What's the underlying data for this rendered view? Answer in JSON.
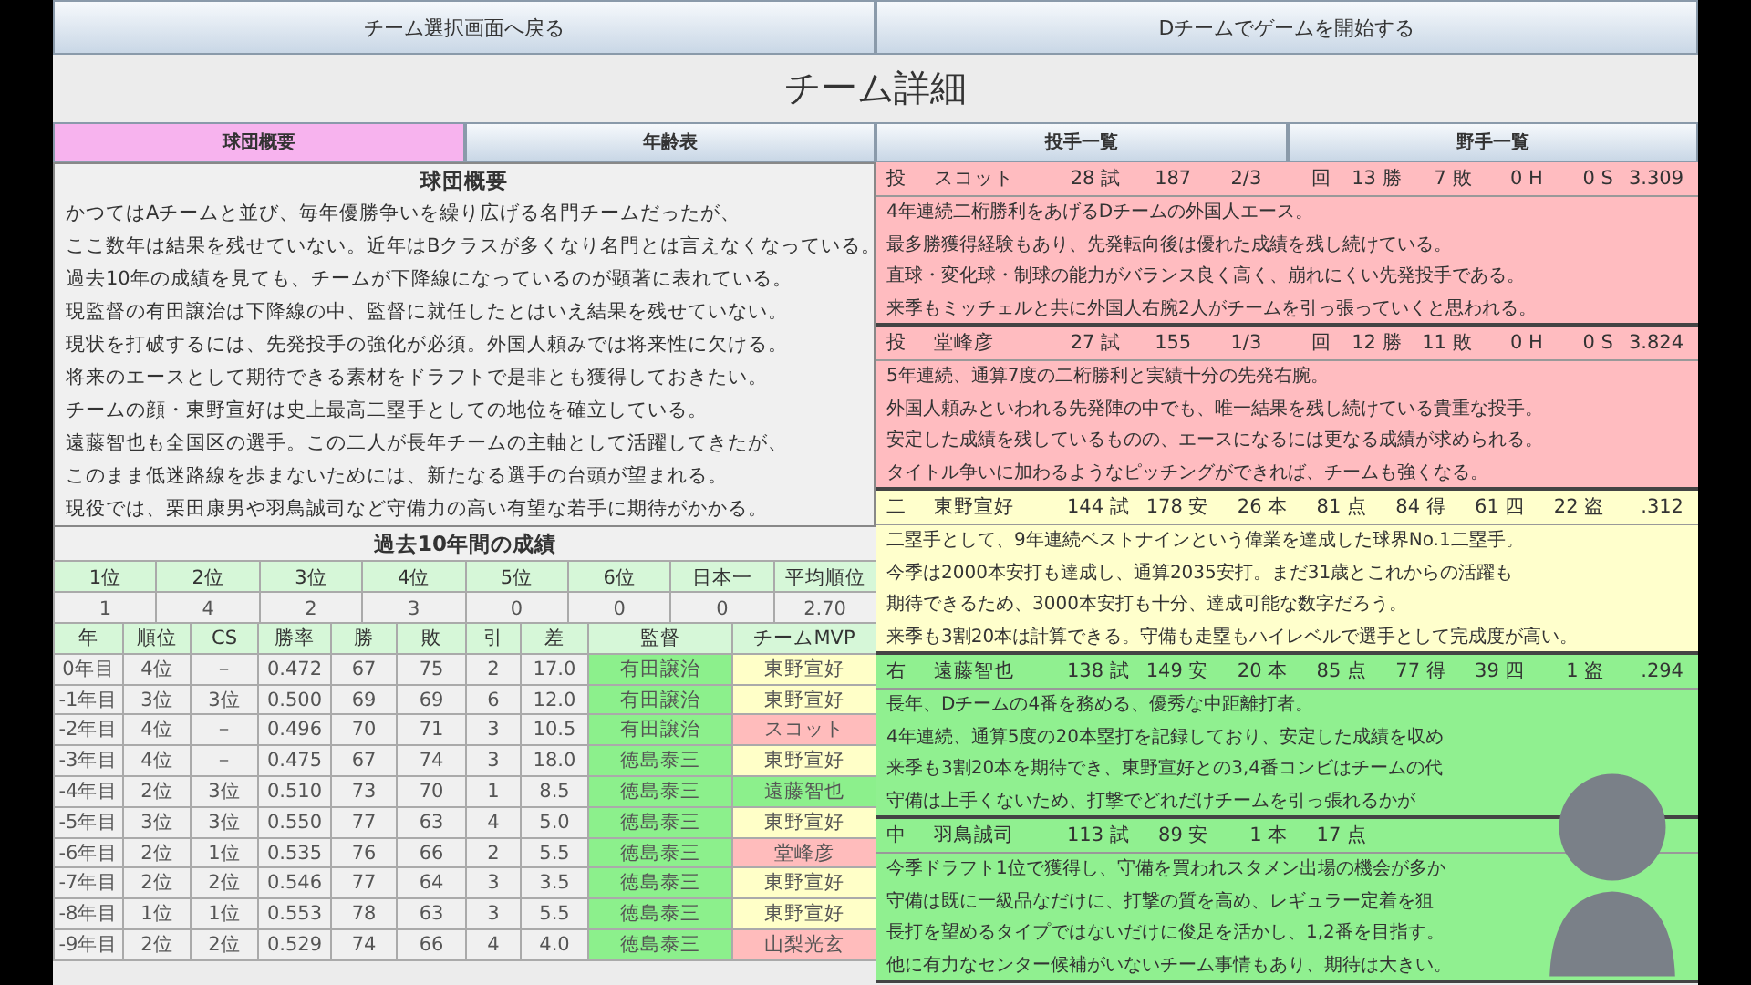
{
  "nav_buttons": [
    "チーム選択画面へ戻る",
    "Dチームでゲームを開始する"
  ],
  "title": "チーム詳細",
  "tabs": [
    {
      "label": "球団概要",
      "selected": true
    },
    {
      "label": "年齢表",
      "selected": false
    },
    {
      "label": "投手一覧",
      "selected": false
    },
    {
      "label": "野手一覧",
      "selected": false
    }
  ],
  "overview": {
    "heading": "球団概要",
    "lines": [
      "かつてはAチームと並び、毎年優勝争いを繰り広げる名門チームだったが、",
      "ここ数年は結果を残せていない。近年はBクラスが多くなり名門とは言えなくなっている。",
      "過去10年の成績を見ても、チームが下降線になっているのが顕著に表れている。",
      "現監督の有田譲治は下降線の中、監督に就任したとはいえ結果を残せていない。",
      "現状を打破するには、先発投手の強化が必須。外国人頼みでは将来性に欠ける。",
      "将来のエースとして期待できる素材をドラフトで是非とも獲得しておきたい。",
      "チームの顔・東野宣好は史上最高二塁手としての地位を確立している。",
      "遠藤智也も全国区の選手。この二人が長年チームの主軸として活躍してきたが、",
      "このまま低迷路線を歩まないためには、新たなる選手の台頭が望まれる。",
      "現役では、栗田康男や羽鳥誠司など守備力の高い有望な若手に期待がかかる。"
    ]
  },
  "history": {
    "heading": "過去10年間の成績",
    "summary_columns": [
      "1位",
      "2位",
      "3位",
      "4位",
      "5位",
      "6位",
      "日本一",
      "平均順位"
    ],
    "summary_values": [
      "1",
      "4",
      "2",
      "3",
      "0",
      "0",
      "0",
      "2.70"
    ],
    "columns": [
      "年",
      "順位",
      "CS",
      "勝率",
      "勝",
      "敗",
      "引",
      "差",
      "監督",
      "チームMVP"
    ],
    "rows": [
      {
        "cells": [
          "0年目",
          "4位",
          "－",
          "0.472",
          "67",
          "75",
          "2",
          "17.0"
        ],
        "manager": "有田譲治",
        "mvp": {
          "name": "東野宣好",
          "color": "#ffffc8"
        }
      },
      {
        "cells": [
          "-1年目",
          "3位",
          "3位",
          "0.500",
          "69",
          "69",
          "6",
          "12.0"
        ],
        "manager": "有田譲治",
        "mvp": {
          "name": "東野宣好",
          "color": "#ffffc8"
        }
      },
      {
        "cells": [
          "-2年目",
          "4位",
          "－",
          "0.496",
          "70",
          "71",
          "3",
          "10.5"
        ],
        "manager": "有田譲治",
        "mvp": {
          "name": "スコット",
          "color": "#ffbcbc"
        }
      },
      {
        "cells": [
          "-3年目",
          "4位",
          "－",
          "0.475",
          "67",
          "74",
          "3",
          "18.0"
        ],
        "manager": "徳島泰三",
        "mvp": {
          "name": "東野宣好",
          "color": "#ffffc8"
        }
      },
      {
        "cells": [
          "-4年目",
          "2位",
          "3位",
          "0.510",
          "73",
          "70",
          "1",
          "8.5"
        ],
        "manager": "徳島泰三",
        "mvp": {
          "name": "遠藤智也",
          "color": "#8cf08c"
        }
      },
      {
        "cells": [
          "-5年目",
          "3位",
          "3位",
          "0.550",
          "77",
          "63",
          "4",
          "5.0"
        ],
        "manager": "徳島泰三",
        "mvp": {
          "name": "東野宣好",
          "color": "#ffffc8"
        }
      },
      {
        "cells": [
          "-6年目",
          "2位",
          "1位",
          "0.535",
          "76",
          "66",
          "2",
          "5.5"
        ],
        "manager": "徳島泰三",
        "mvp": {
          "name": "堂峰彦",
          "color": "#ffbcbc"
        }
      },
      {
        "cells": [
          "-7年目",
          "2位",
          "2位",
          "0.546",
          "77",
          "64",
          "3",
          "3.5"
        ],
        "manager": "徳島泰三",
        "mvp": {
          "name": "東野宣好",
          "color": "#ffffc8"
        }
      },
      {
        "cells": [
          "-8年目",
          "1位",
          "1位",
          "0.553",
          "78",
          "63",
          "3",
          "5.5"
        ],
        "manager": "徳島泰三",
        "mvp": {
          "name": "東野宣好",
          "color": "#ffffc8"
        }
      },
      {
        "cells": [
          "-9年目",
          "2位",
          "2位",
          "0.529",
          "74",
          "66",
          "4",
          "4.0"
        ],
        "manager": "徳島泰三",
        "mvp": {
          "name": "山梨光玄",
          "color": "#ffbcbc"
        }
      }
    ]
  },
  "players": [
    {
      "kind": "pitcher",
      "position": "投",
      "name": "スコット",
      "color": "#ffbcc0",
      "stats": [
        "28 試",
        "187",
        "2/3",
        "回",
        "13 勝",
        "7 敗",
        "0 H",
        "0 S",
        "3.309"
      ],
      "notes": [
        "4年連続二桁勝利をあげるDチームの外国人エース。",
        "最多勝獲得経験もあり、先発転向後は優れた成績を残し続けている。",
        "直球・変化球・制球の能力がバランス良く高く、崩れにくい先発投手である。",
        "来季もミッチェルと共に外国人右腕2人がチームを引っ張っていくと思われる。"
      ]
    },
    {
      "kind": "pitcher",
      "position": "投",
      "name": "堂峰彦",
      "color": "#ffbcc0",
      "stats": [
        "27 試",
        "155",
        "1/3",
        "回",
        "12 勝",
        "11 敗",
        "0 H",
        "0 S",
        "3.824"
      ],
      "notes": [
        "5年連続、通算7度の二桁勝利と実績十分の先発右腕。",
        "外国人頼みといわれる先発陣の中でも、唯一結果を残し続けている貴重な投手。",
        "安定した成績を残しているものの、エースになるには更なる成績が求められる。",
        "タイトル争いに加わるようなピッチングができれば、チームも強くなる。"
      ]
    },
    {
      "kind": "batter",
      "position": "二",
      "name": "東野宣好",
      "color": "#ffffcc",
      "stats": [
        "144 試",
        "178 安",
        "26 本",
        "81 点",
        "84 得",
        "61 四",
        "22 盗",
        ".312"
      ],
      "notes": [
        "二塁手として、9年連続ベストナインという偉業を達成した球界No.1二塁手。",
        "今季は2000本安打も達成し、通算2035安打。まだ31歳とこれからの活躍も",
        "期待できるため、3000本安打も十分、達成可能な数字だろう。",
        "来季も3割20本は計算できる。守備も走塁もハイレベルで選手として完成度が高い。"
      ]
    },
    {
      "kind": "batter",
      "position": "右",
      "name": "遠藤智也",
      "color": "#90f090",
      "stats": [
        "138 試",
        "149 安",
        "20 本",
        "85 点",
        "77 得",
        "39 四",
        "1 盗",
        ".294"
      ],
      "notes": [
        "長年、Dチームの4番を務める、優秀な中距離打者。",
        "4年連続、通算5度の20本塁打を記録しており、安定した成績を収め",
        "来季も3割20本を期待でき、東野宣好との3,4番コンビはチームの代",
        "守備は上手くないため、打撃でどれだけチームを引っ張れるかが"
      ]
    },
    {
      "kind": "batter",
      "position": "中",
      "name": "羽鳥誠司",
      "color": "#90f090",
      "stats": [
        "113 試",
        "89 安",
        "1 本",
        "17 点"
      ],
      "notes": [
        "今季ドラフト1位で獲得し、守備を買われスタメン出場の機会が多か",
        "守備は既に一級品なだけに、打撃の質を高め、レギュラー定着を狙",
        "長打を望めるタイプではないだけに俊足を活かし、1,2番を目指す。",
        "他に有力なセンター候補がいないチーム事情もあり、期待は大きい。"
      ]
    }
  ]
}
